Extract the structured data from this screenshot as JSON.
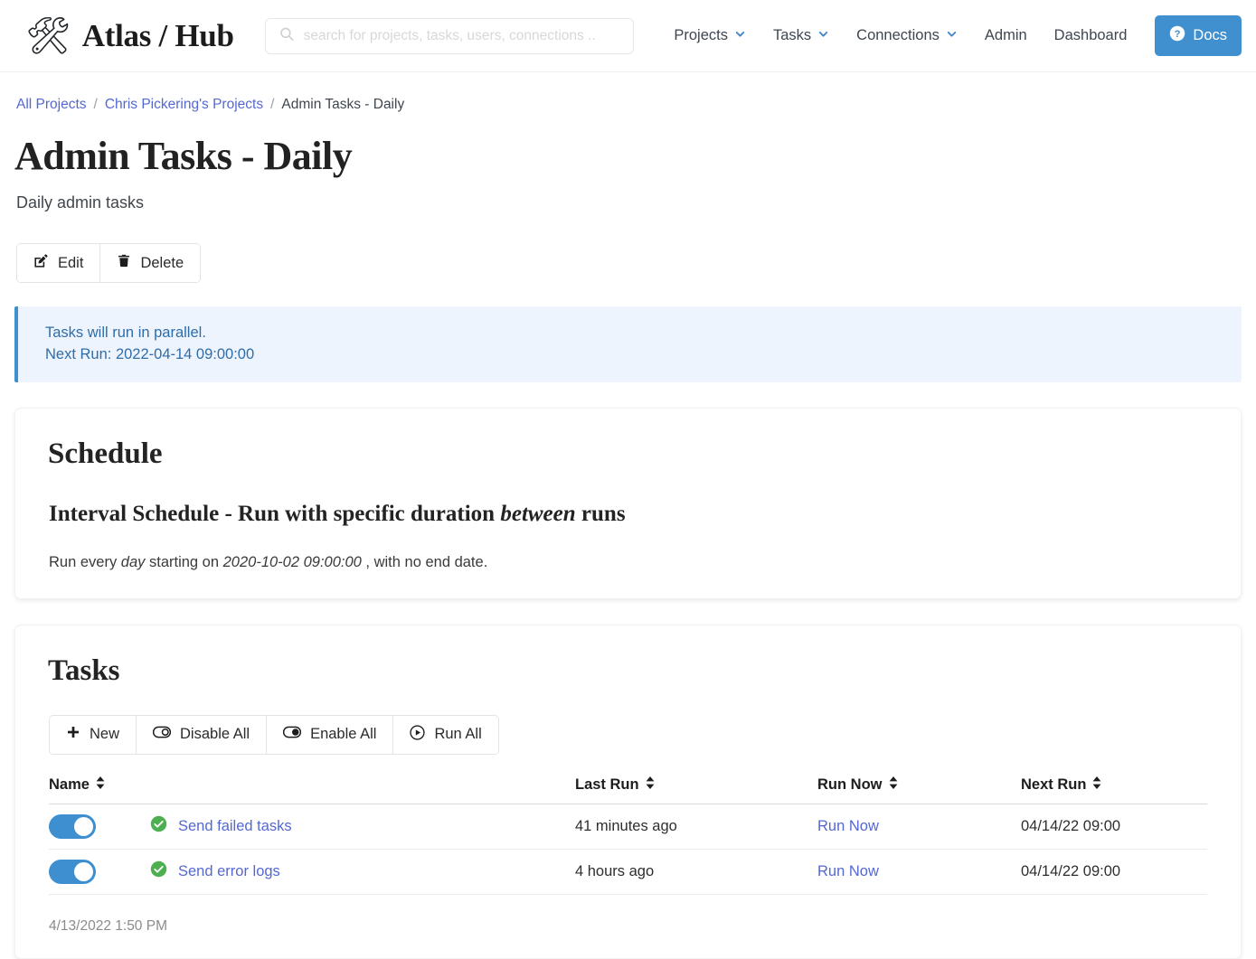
{
  "header": {
    "brand_icon": "hammer-and-wrench",
    "brand_glyph": "🛠",
    "brand_text": "Atlas / Hub",
    "search": {
      "placeholder": "search for projects, tasks, users, connections ..",
      "value": "",
      "icon": "search-icon"
    },
    "nav": [
      {
        "label": "Projects",
        "has_dropdown": true
      },
      {
        "label": "Tasks",
        "has_dropdown": true
      },
      {
        "label": "Connections",
        "has_dropdown": true
      },
      {
        "label": "Admin",
        "has_dropdown": false
      },
      {
        "label": "Dashboard",
        "has_dropdown": false
      }
    ],
    "docs_button": {
      "label": "Docs",
      "icon": "question-circle-icon",
      "color": "#4090cf"
    }
  },
  "breadcrumb": {
    "items": [
      {
        "label": "All Projects",
        "link": true
      },
      {
        "label": "Chris Pickering's Projects",
        "link": true
      },
      {
        "label": "Admin Tasks - Daily",
        "link": false
      }
    ],
    "separator": "/"
  },
  "page": {
    "title": "Admin Tasks - Daily",
    "subtitle": "Daily admin tasks",
    "actions": [
      {
        "label": "Edit",
        "icon": "pencil-square-icon"
      },
      {
        "label": "Delete",
        "icon": "trash-icon"
      }
    ],
    "alert": {
      "line1": "Tasks will run in parallel.",
      "line2": "Next Run: 2022-04-14 09:00:00",
      "accent": "#4090cf",
      "background": "#eef4fd"
    }
  },
  "schedule": {
    "card_title": "Schedule",
    "heading_before": "Interval Schedule - Run with specific duration ",
    "heading_em": "between",
    "heading_after": " runs",
    "body_pre": "Run every ",
    "body_interval": "day",
    "body_mid": " starting on ",
    "body_start": "2020-10-02 09:00:00",
    "body_post": " , with no end date."
  },
  "tasks": {
    "card_title": "Tasks",
    "toolbar": [
      {
        "label": "New",
        "icon": "plus-icon"
      },
      {
        "label": "Disable All",
        "icon": "toggle-off-icon"
      },
      {
        "label": "Enable All",
        "icon": "toggle-on-icon"
      },
      {
        "label": "Run All",
        "icon": "play-circle-icon"
      }
    ],
    "columns": [
      {
        "label": "Name",
        "sortable": true
      },
      {
        "label": "Last Run",
        "sortable": true
      },
      {
        "label": "Run Now",
        "sortable": true
      },
      {
        "label": "Next Run",
        "sortable": true
      }
    ],
    "rows": [
      {
        "enabled": true,
        "status_icon": "check-circle-icon",
        "name": "Send failed tasks",
        "last_run": "41 minutes ago",
        "run_now": "Run Now",
        "next_run": "04/14/22 09:00"
      },
      {
        "enabled": true,
        "status_icon": "check-circle-icon",
        "name": "Send error logs",
        "last_run": "4 hours ago",
        "run_now": "Run Now",
        "next_run": "04/14/22 09:00"
      }
    ],
    "footer_timestamp": "4/13/2022 1:50 PM"
  },
  "colors": {
    "primary": "#4090cf",
    "link": "#5468d4",
    "success": "#4caf50",
    "toggle_on": "#3d8fd0"
  }
}
